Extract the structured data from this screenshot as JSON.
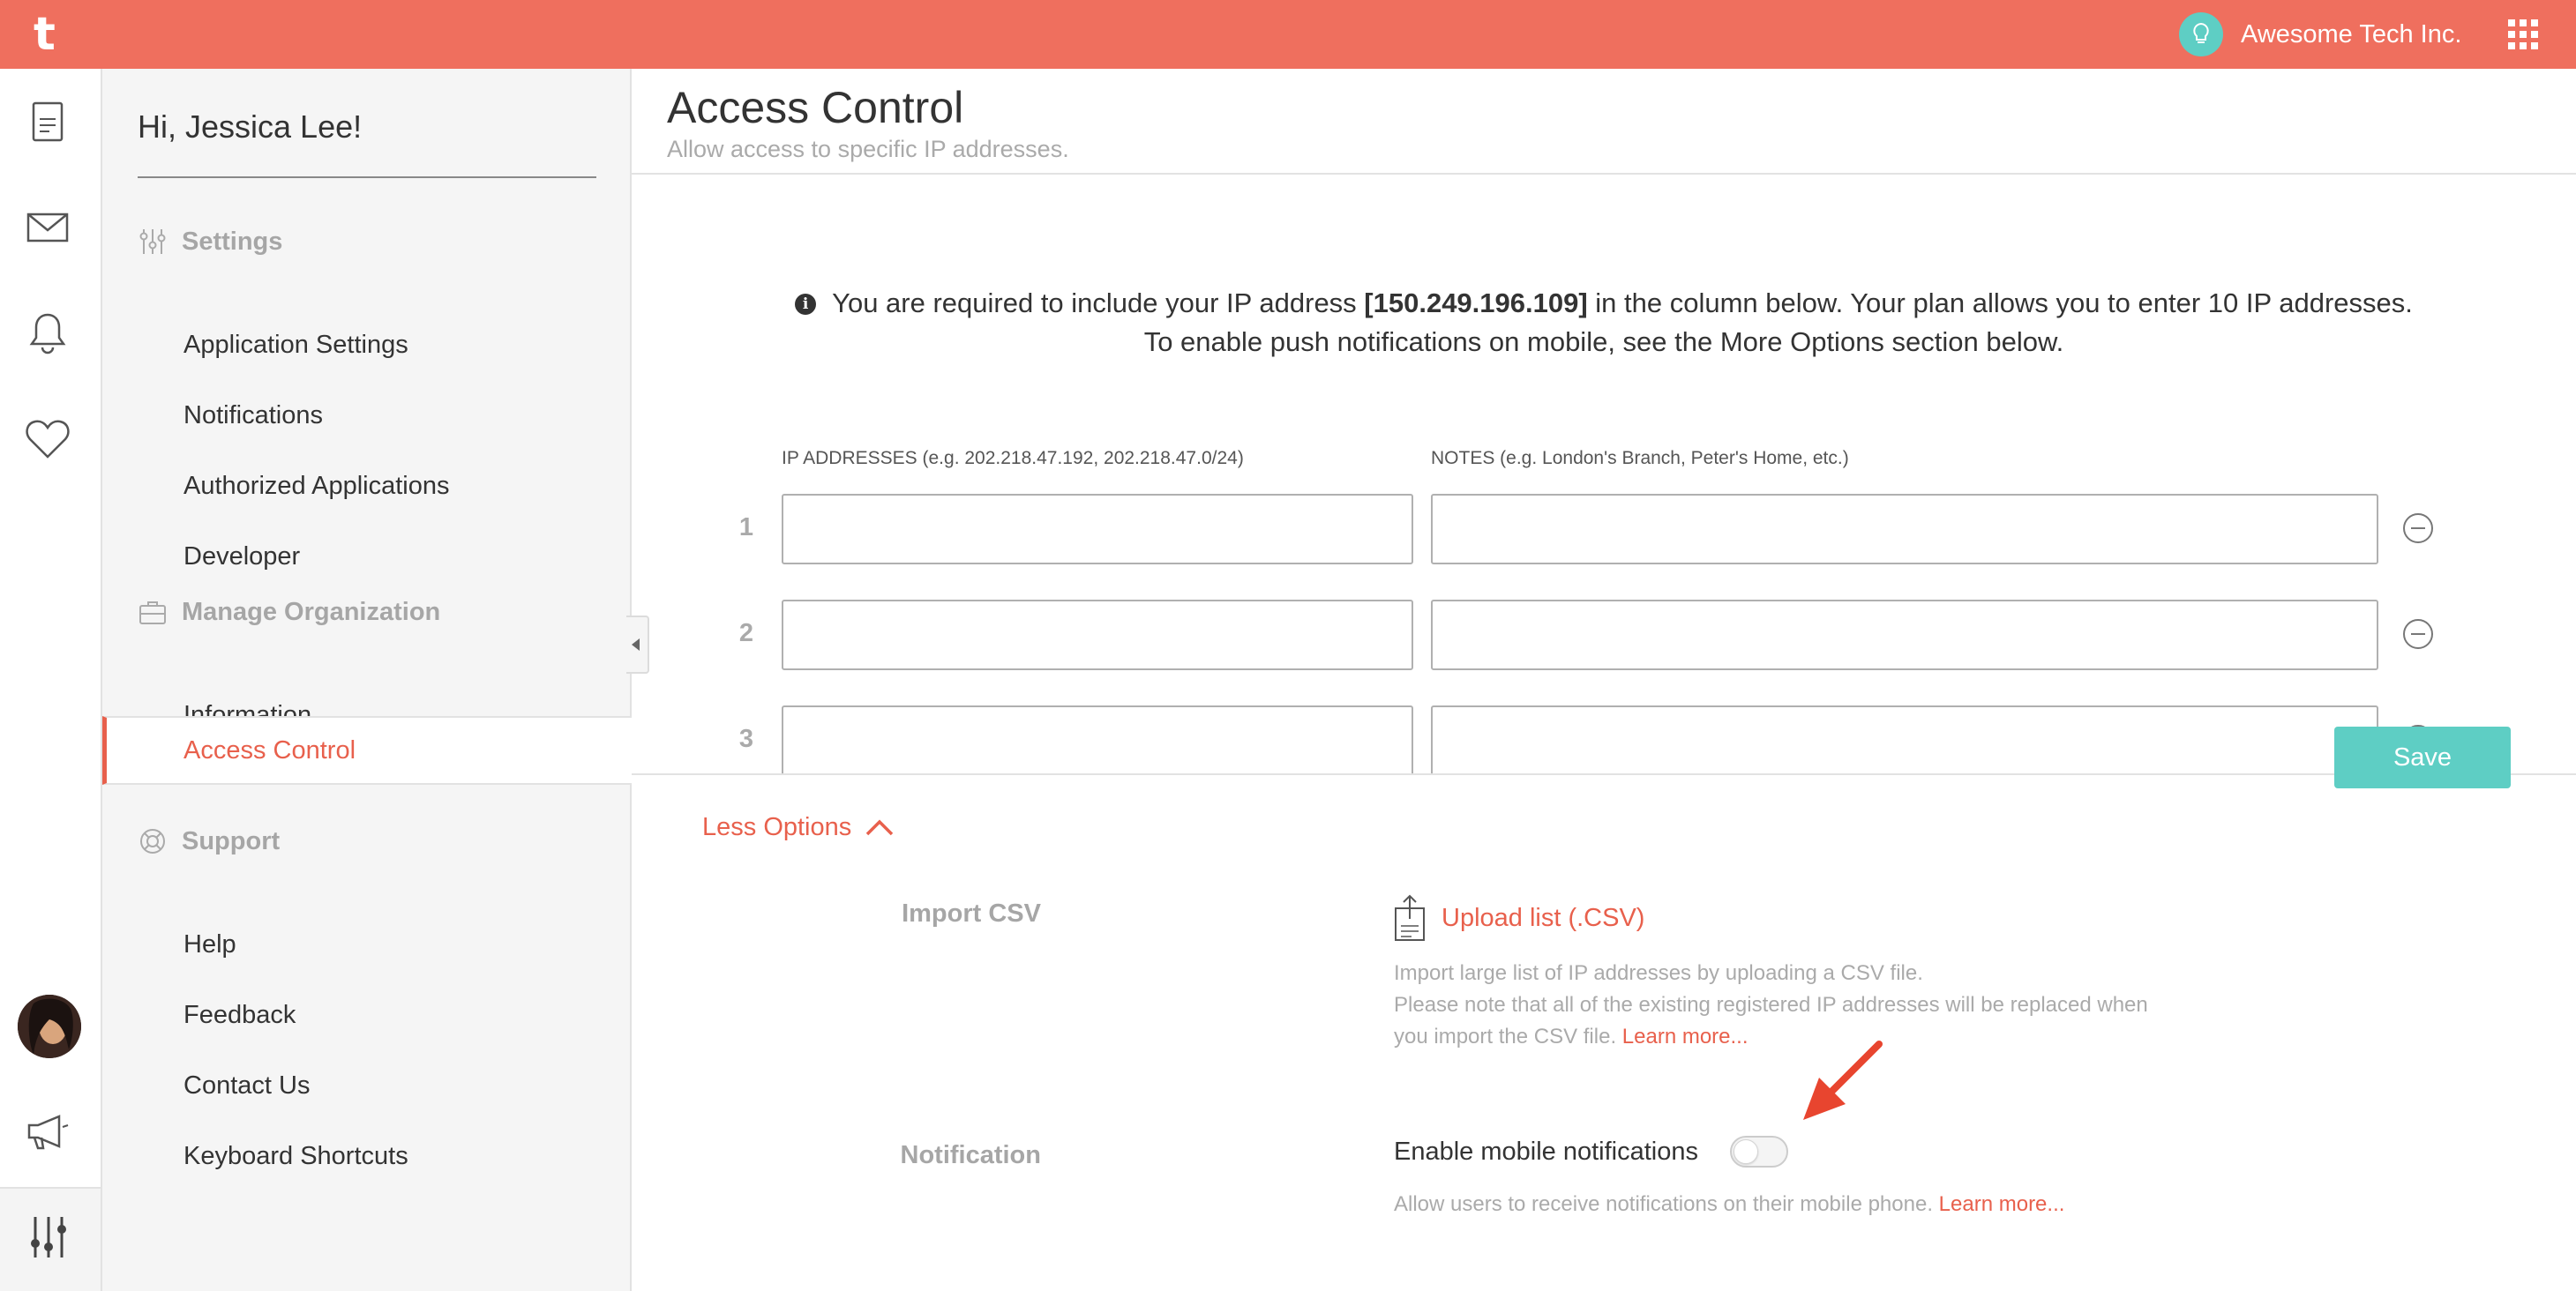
{
  "topbar": {
    "logo": "t",
    "org_name": "Awesome Tech Inc.",
    "accent_color": "#EF6F5E"
  },
  "rail": {
    "icons": [
      "document-icon",
      "mail-icon",
      "bell-icon",
      "heart-icon",
      "avatar",
      "megaphone-icon",
      "sliders-icon"
    ]
  },
  "sidebar": {
    "greeting": "Hi, Jessica Lee!",
    "settings": {
      "title": "Settings",
      "items": [
        "Application Settings",
        "Notifications",
        "Authorized Applications",
        "Developer"
      ]
    },
    "manage": {
      "title": "Manage Organization",
      "items": [
        "Information",
        "Access Control"
      ]
    },
    "support": {
      "title": "Support",
      "items": [
        "Help",
        "Feedback",
        "Contact Us",
        "Keyboard Shortcuts"
      ]
    },
    "active_item": "Access Control"
  },
  "main": {
    "title": "Access Control",
    "subtitle": "Allow access to specific IP addresses.",
    "info_line1_pre": "You are required to include your IP address ",
    "info_ip": "[150.249.196.109]",
    "info_line1_post": " in the column below. Your plan allows you to enter 10 IP addresses.",
    "info_line2": "To enable push notifications on mobile, see the More Options section below.",
    "col_ip": "IP ADDRESSES (e.g. 202.218.47.192, 202.218.47.0/24)",
    "col_notes": "NOTES (e.g. London's Branch, Peter's Home, etc.)",
    "rows": [
      {
        "num": "1",
        "ip": "",
        "note": ""
      },
      {
        "num": "2",
        "ip": "",
        "note": ""
      },
      {
        "num": "3",
        "ip": "",
        "note": ""
      }
    ],
    "less_options": "Less Options",
    "save": "Save",
    "import_label": "Import CSV",
    "upload_label": "Upload list (.CSV)",
    "import_help1": "Import large list of IP addresses by uploading a CSV file.",
    "import_help2": "Please note that all of the existing registered IP addresses will be replaced when",
    "import_help3": "you import the CSV file. ",
    "learn_more": "Learn more...",
    "notification_label": "Notification",
    "toggle_label": "Enable mobile notifications",
    "toggle_on": false,
    "notif_help": "Allow users to receive notifications on their mobile phone. ",
    "save_color": "#5ECEC4",
    "link_color": "#E8604C"
  }
}
